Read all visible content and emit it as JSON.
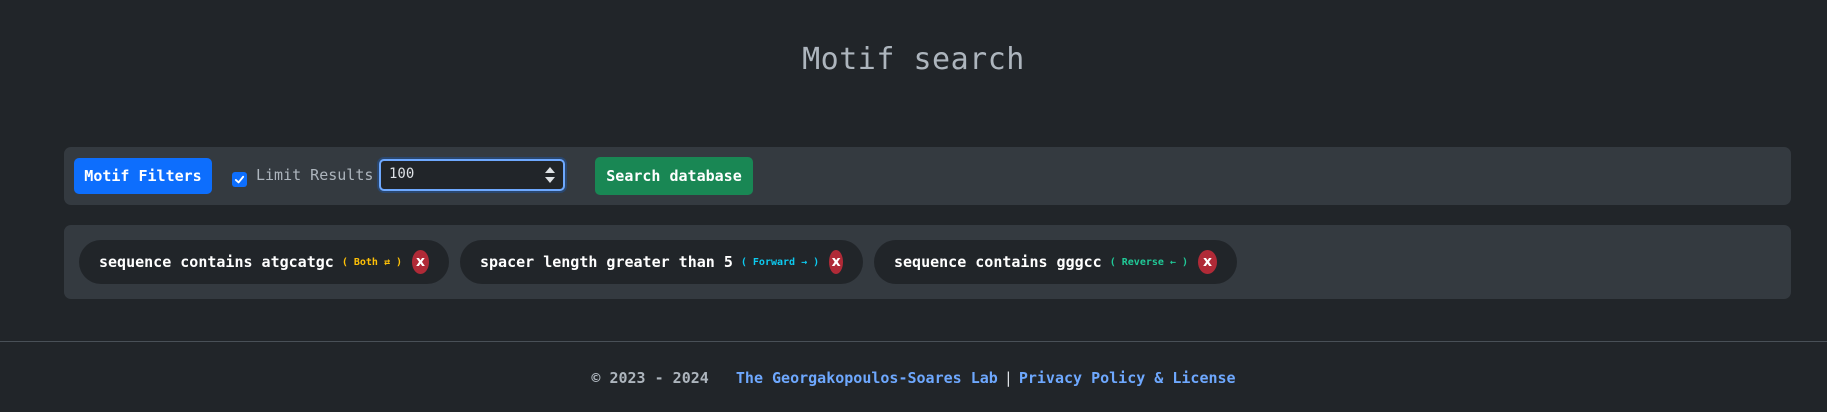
{
  "page": {
    "title": "Motif search"
  },
  "toolbar": {
    "filters_button": "Motif Filters",
    "limit_checked": true,
    "limit_label": "Limit Results",
    "limit_value": "100",
    "search_button": "Search database"
  },
  "filters": [
    {
      "text": "sequence contains atgcatgc",
      "strand": "( Both ⇄ )",
      "remove": "x"
    },
    {
      "text": "spacer length greater than 5",
      "strand": "( Forward → )",
      "remove": "x"
    },
    {
      "text": "sequence contains gggcc",
      "strand": "( Reverse ← )",
      "remove": "x"
    }
  ],
  "colors": {
    "background": "#212529",
    "panel": "#343a40",
    "primary": "#0d6efd",
    "success": "#198754",
    "danger": "#b02a37",
    "both": "#ffc107",
    "forward": "#0dcaf0",
    "reverse": "#20c997"
  },
  "footer": {
    "copyright": "© 2023 - 2024",
    "lab_link": "The Georgakopoulos-Soares Lab",
    "separator": "|",
    "policy_link": "Privacy Policy & License"
  }
}
